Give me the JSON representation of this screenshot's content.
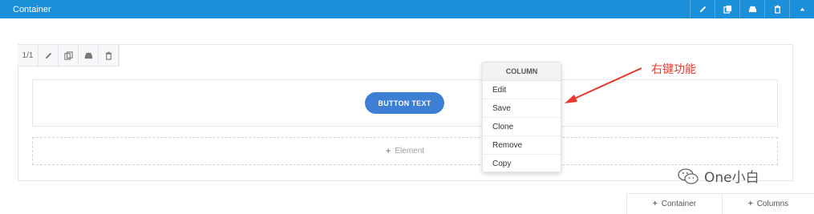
{
  "topbar": {
    "title": "Container",
    "tools": [
      "pencil-icon",
      "clone-icon",
      "save-icon",
      "trash-icon",
      "caret-up-icon"
    ]
  },
  "column_toolbar": {
    "count": "1/1",
    "tools": [
      "pencil-icon",
      "clone-icon",
      "save-icon",
      "trash-icon"
    ]
  },
  "button": {
    "label": "BUTTON TEXT"
  },
  "add_element": {
    "label": "Element",
    "plus": "+"
  },
  "context_menu": {
    "header": "COLUMN",
    "items": [
      "Edit",
      "Save",
      "Clone",
      "Remove",
      "Copy"
    ]
  },
  "annotation": {
    "text": "右键功能",
    "color": "#e8382d"
  },
  "watermark": {
    "text": "One小白"
  },
  "bottom_tabs": {
    "container_label": "Container",
    "columns_label": "Columns",
    "plus": "+"
  },
  "colors": {
    "topbar": "#1c8fd9",
    "button": "#3e7fd6"
  }
}
